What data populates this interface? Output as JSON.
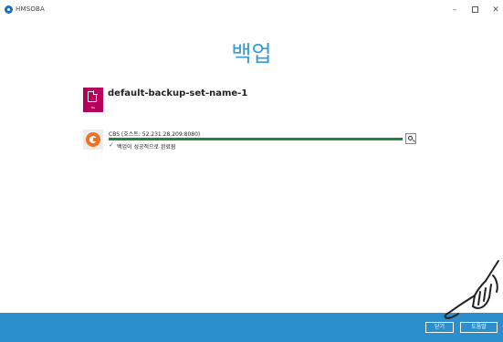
{
  "window": {
    "title": "HMSOBA",
    "minimize_glyph": "–",
    "close_glyph": "✕"
  },
  "page": {
    "title": "백업"
  },
  "backup_set": {
    "icon_tag": "file",
    "name": "default-backup-set-name-1"
  },
  "destination": {
    "label": "CBS (호스트: 52.231.28.209:8080)",
    "progress_percent": 100,
    "status_check": "✓",
    "status_text": "백업이 성공적으로 완료됨"
  },
  "footer": {
    "close_label": "닫기",
    "help_label": "도움말"
  },
  "colors": {
    "accent": "#2b8fcd",
    "title": "#3a9ad6",
    "progress": "#1a8a3a",
    "backup_set_icon": "#b5005c",
    "destination_icon": "#f37021"
  },
  "icons": {
    "app": "app-logo-icon",
    "backup_set": "file-icon",
    "destination": "cbs-icon",
    "detail": "magnifier-icon",
    "cursor": "hand-pointer-icon"
  }
}
